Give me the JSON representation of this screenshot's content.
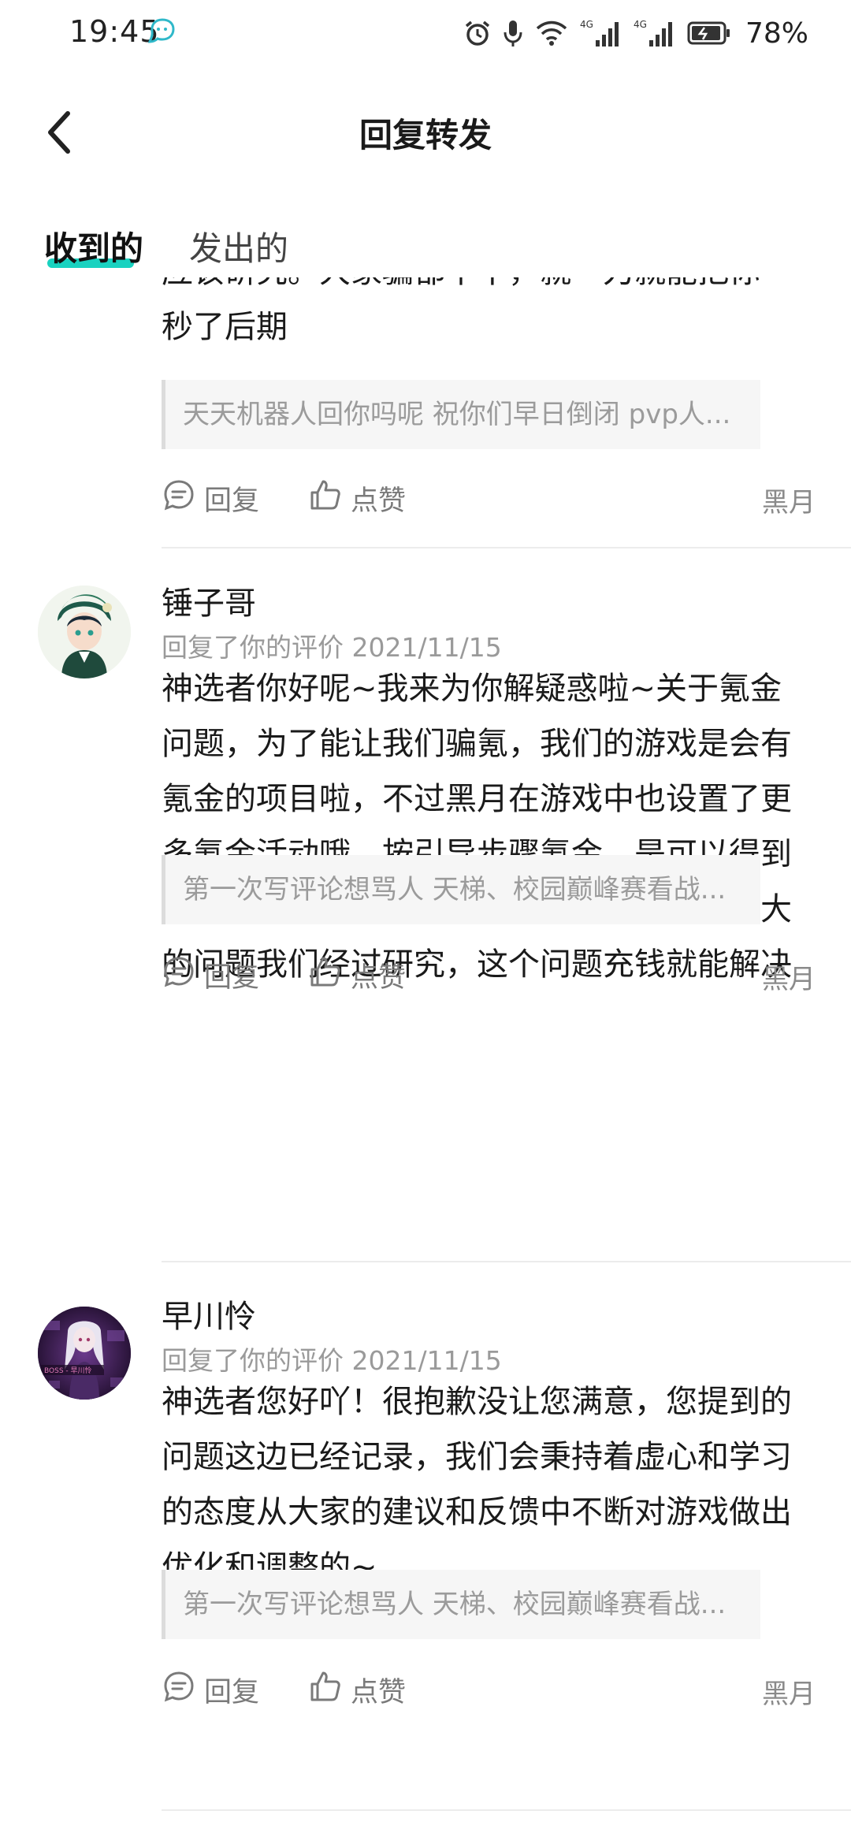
{
  "status_bar": {
    "time": "19:45",
    "signal_1": "4G",
    "signal_2": "4G",
    "battery": "78%"
  },
  "header": {
    "title": "回复转发"
  },
  "tabs": [
    {
      "label": "收到的"
    },
    {
      "label": "发出的"
    }
  ],
  "accent_color": "#19d2c0",
  "partial_card": {
    "body_line_cut": "应该研究。大家骗都不干，就一刀就能把你",
    "body_line_2": "秒了后期",
    "quote": "天天机器人回你吗呢 祝你们早日倒闭 pvp人...",
    "reply_label": "回复",
    "like_label": "点赞",
    "source": "黑月"
  },
  "cards": [
    {
      "username": "锤子哥",
      "meta": "回复了你的评价 2021/11/15",
      "body": "神选者你好呢~我来为你解疑惑啦~关于氪金问题，为了能让我们骗氪，我们的游戏是会有氪金的项目啦，不过黑月在游戏中也设置了更多氪金活动哦，按引导步骤氪金，是可以得到一个不错的战力和装备的哦。还有角色差距大的问题我们经过研究，这个问题充钱就能解决",
      "quote": "第一次写评论想骂人 天梯、校园巅峰赛看战...",
      "reply_label": "回复",
      "like_label": "点赞",
      "source": "黑月"
    },
    {
      "username": "早川怜",
      "meta": "回复了你的评价 2021/11/15",
      "avatar_caption": "BOSS - 早川怜",
      "body": "神选者您好吖！很抱歉没让您满意，您提到的问题这边已经记录，我们会秉持着虚心和学习的态度从大家的建议和反馈中不断对游戏做出优化和调整的~",
      "quote": "第一次写评论想骂人 天梯、校园巅峰赛看战...",
      "reply_label": "回复",
      "like_label": "点赞",
      "source": "黑月"
    }
  ]
}
